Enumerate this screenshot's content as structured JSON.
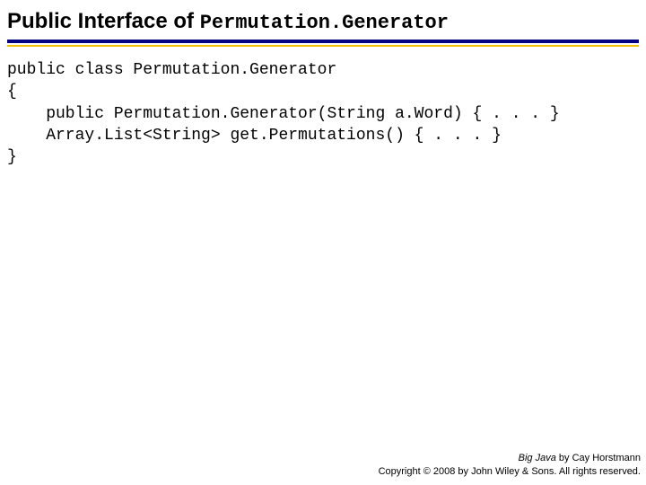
{
  "title": {
    "prefix": "Public Interface of ",
    "classname": "Permutation.Generator"
  },
  "code": {
    "line1": "public class Permutation.Generator",
    "line2": "{",
    "line3": "    public Permutation.Generator(String a.Word) { . . . }",
    "line4": "    Array.List<String> get.Permutations() { . . . }",
    "line5": "}"
  },
  "footer": {
    "book_title": "Big Java",
    "byline": " by Cay Horstmann",
    "copyright": "Copyright © 2008 by John Wiley & Sons. All rights reserved."
  }
}
